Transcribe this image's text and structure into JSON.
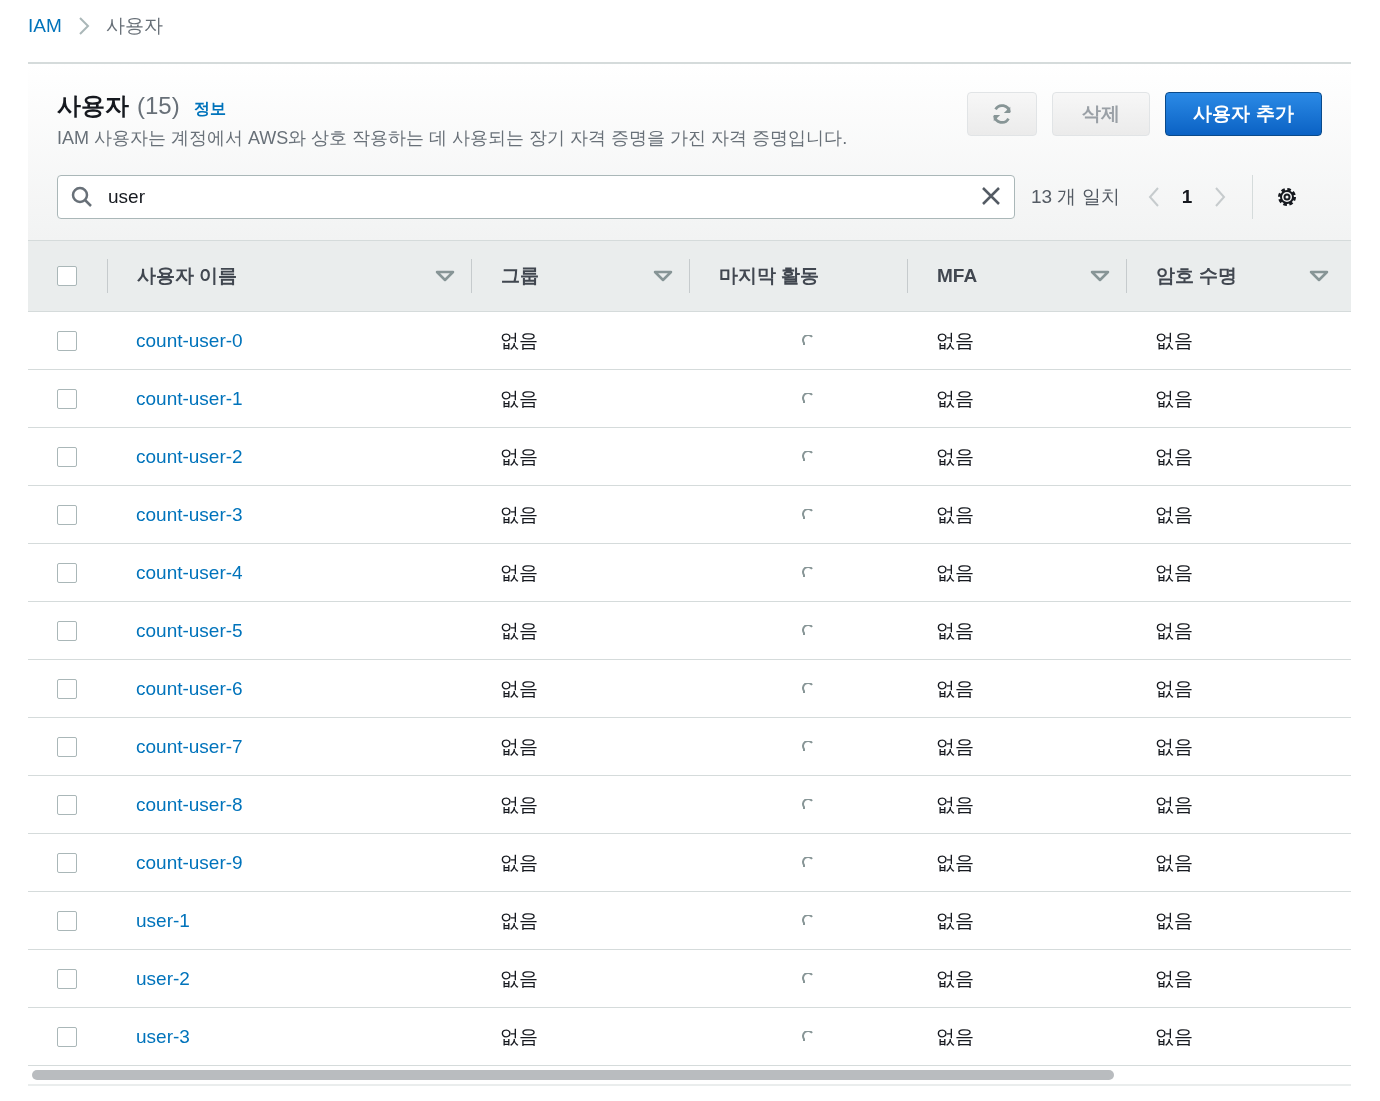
{
  "breadcrumb": [
    {
      "label": "IAM",
      "link": true
    },
    {
      "label": "사용자",
      "link": false
    }
  ],
  "header": {
    "title": "사용자",
    "count": "(15)",
    "info": "정보",
    "description": "IAM 사용자는 계정에서 AWS와 상호 작용하는 데 사용되는 장기 자격 증명을 가진 자격 증명입니다."
  },
  "actions": [
    {
      "kind": "refresh"
    },
    {
      "kind": "secondary",
      "label": "삭제"
    },
    {
      "kind": "primary",
      "label": "사용자 추가"
    }
  ],
  "search": {
    "value": "user",
    "match_count": "13 개 일치"
  },
  "pagination": {
    "page": "1"
  },
  "table": {
    "select_all_checked": false,
    "columns": [
      {
        "label": "사용자 이름",
        "sortable": true
      },
      {
        "label": "그룹",
        "sortable": true
      },
      {
        "label": "마지막 활동",
        "sortable": false
      },
      {
        "label": "MFA",
        "sortable": true
      },
      {
        "label": "암호 수명",
        "sortable": true
      }
    ],
    "rows": [
      {
        "checked": false,
        "name": "count-user-0",
        "group": "없음",
        "last_activity_loading": true,
        "mfa": "없음",
        "password_age": "없음"
      },
      {
        "checked": false,
        "name": "count-user-1",
        "group": "없음",
        "last_activity_loading": true,
        "mfa": "없음",
        "password_age": "없음"
      },
      {
        "checked": false,
        "name": "count-user-2",
        "group": "없음",
        "last_activity_loading": true,
        "mfa": "없음",
        "password_age": "없음"
      },
      {
        "checked": false,
        "name": "count-user-3",
        "group": "없음",
        "last_activity_loading": true,
        "mfa": "없음",
        "password_age": "없음"
      },
      {
        "checked": false,
        "name": "count-user-4",
        "group": "없음",
        "last_activity_loading": true,
        "mfa": "없음",
        "password_age": "없음"
      },
      {
        "checked": false,
        "name": "count-user-5",
        "group": "없음",
        "last_activity_loading": true,
        "mfa": "없음",
        "password_age": "없음"
      },
      {
        "checked": false,
        "name": "count-user-6",
        "group": "없음",
        "last_activity_loading": true,
        "mfa": "없음",
        "password_age": "없음"
      },
      {
        "checked": false,
        "name": "count-user-7",
        "group": "없음",
        "last_activity_loading": true,
        "mfa": "없음",
        "password_age": "없음"
      },
      {
        "checked": false,
        "name": "count-user-8",
        "group": "없음",
        "last_activity_loading": true,
        "mfa": "없음",
        "password_age": "없음"
      },
      {
        "checked": false,
        "name": "count-user-9",
        "group": "없음",
        "last_activity_loading": true,
        "mfa": "없음",
        "password_age": "없음"
      },
      {
        "checked": false,
        "name": "user-1",
        "group": "없음",
        "last_activity_loading": true,
        "mfa": "없음",
        "password_age": "없음"
      },
      {
        "checked": false,
        "name": "user-2",
        "group": "없음",
        "last_activity_loading": true,
        "mfa": "없음",
        "password_age": "없음"
      },
      {
        "checked": false,
        "name": "user-3",
        "group": "없음",
        "last_activity_loading": true,
        "mfa": "없음",
        "password_age": "없음"
      }
    ]
  }
}
